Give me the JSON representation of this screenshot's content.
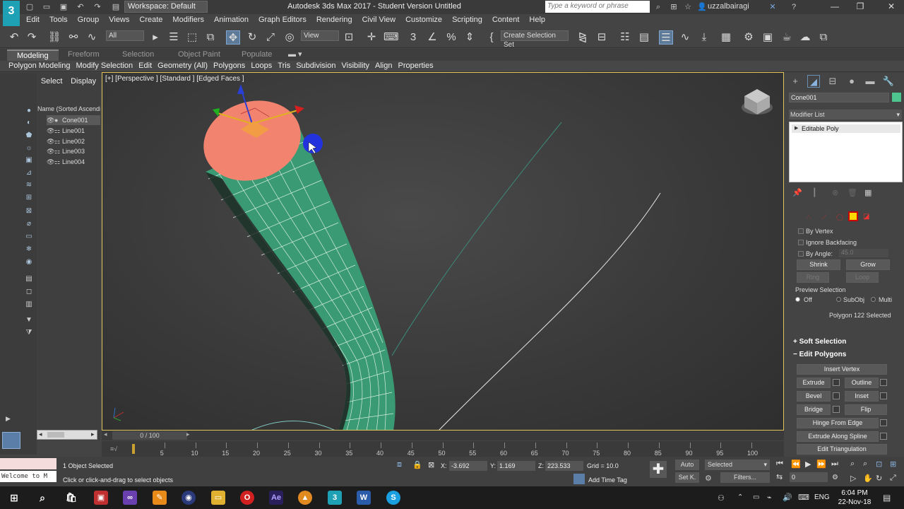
{
  "titlebar": {
    "logo": "3",
    "workspace": "Workspace: Default",
    "app_title": "Autodesk 3ds Max 2017 - Student Version    Untitled",
    "search_placeholder": "Type a keyword or phrase",
    "username": "uzzalbairagi"
  },
  "menubar": [
    "Edit",
    "Tools",
    "Group",
    "Views",
    "Create",
    "Modifiers",
    "Animation",
    "Graph Editors",
    "Rendering",
    "Civil View",
    "Customize",
    "Scripting",
    "Content",
    "Help"
  ],
  "toolbar": {
    "filter": "All",
    "view_dropdown": "View",
    "selection_set": "Create Selection Set"
  },
  "ribbon": {
    "tabs": [
      "Modeling",
      "Freeform",
      "Selection",
      "Object Paint",
      "Populate"
    ],
    "active_tab": "Modeling",
    "sub_items": [
      "Polygon Modeling",
      "Modify Selection",
      "Edit",
      "Geometry (All)",
      "Polygons",
      "Loops",
      "Tris",
      "Subdivision",
      "Visibility",
      "Align",
      "Properties"
    ]
  },
  "explorer": {
    "tabs": [
      "Select",
      "Display"
    ],
    "header": "Name (Sorted Ascending)",
    "items": [
      "Cone001",
      "Line001",
      "Line002",
      "Line003",
      "Line004"
    ],
    "selected": "Cone001"
  },
  "viewport": {
    "label": "[+] [Perspective ] [Standard ] [Edged Faces ]"
  },
  "cmdpanel": {
    "object_name": "Cone001",
    "object_color": "#4ec58f",
    "modifier_list": "Modifier List",
    "stack_item": "Editable Poly",
    "by_vertex": "By Vertex",
    "ignore_backfacing": "Ignore Backfacing",
    "by_angle": "By Angle:",
    "angle_value": "45.0",
    "shrink": "Shrink",
    "grow": "Grow",
    "ring": "Ring",
    "loop": "Loop",
    "preview_selection": "Preview Selection",
    "preview_off": "Off",
    "preview_subobj": "SubObj",
    "preview_multi": "Multi",
    "selection_status": "Polygon 122 Selected",
    "soft_selection": "Soft Selection",
    "edit_polygons": "Edit Polygons",
    "insert_vertex": "Insert Vertex",
    "extrude": "Extrude",
    "outline": "Outline",
    "bevel": "Bevel",
    "inset": "Inset",
    "bridge": "Bridge",
    "flip": "Flip",
    "hinge_from_edge": "Hinge From Edge",
    "extrude_along_spline": "Extrude Along Spline",
    "edit_triangulation": "Edit Triangulation"
  },
  "timeline": {
    "frame_counter": "0 / 100",
    "ticks": [
      "5",
      "10",
      "15",
      "20",
      "25",
      "30",
      "35",
      "40",
      "45",
      "50",
      "55",
      "60",
      "65",
      "70",
      "75",
      "80",
      "85",
      "90",
      "95",
      "100"
    ]
  },
  "status": {
    "maxscript": "Welcome to M",
    "selected_count": "1 Object Selected",
    "prompt": "Click or click-and-drag to select objects",
    "x_label": "X:",
    "x_value": "-3.692",
    "y_label": "Y:",
    "y_value": "1.169",
    "z_label": "Z:",
    "z_value": "223.533",
    "grid": "Grid = 10.0",
    "add_time_tag": "Add Time Tag",
    "auto": "Auto",
    "set_k": "Set K.",
    "selected_dd": "Selected",
    "filters": "Filters...",
    "frame_field": "0"
  },
  "taskbar": {
    "lang": "ENG",
    "time": "6:04 PM",
    "date": "22-Nov-18"
  }
}
